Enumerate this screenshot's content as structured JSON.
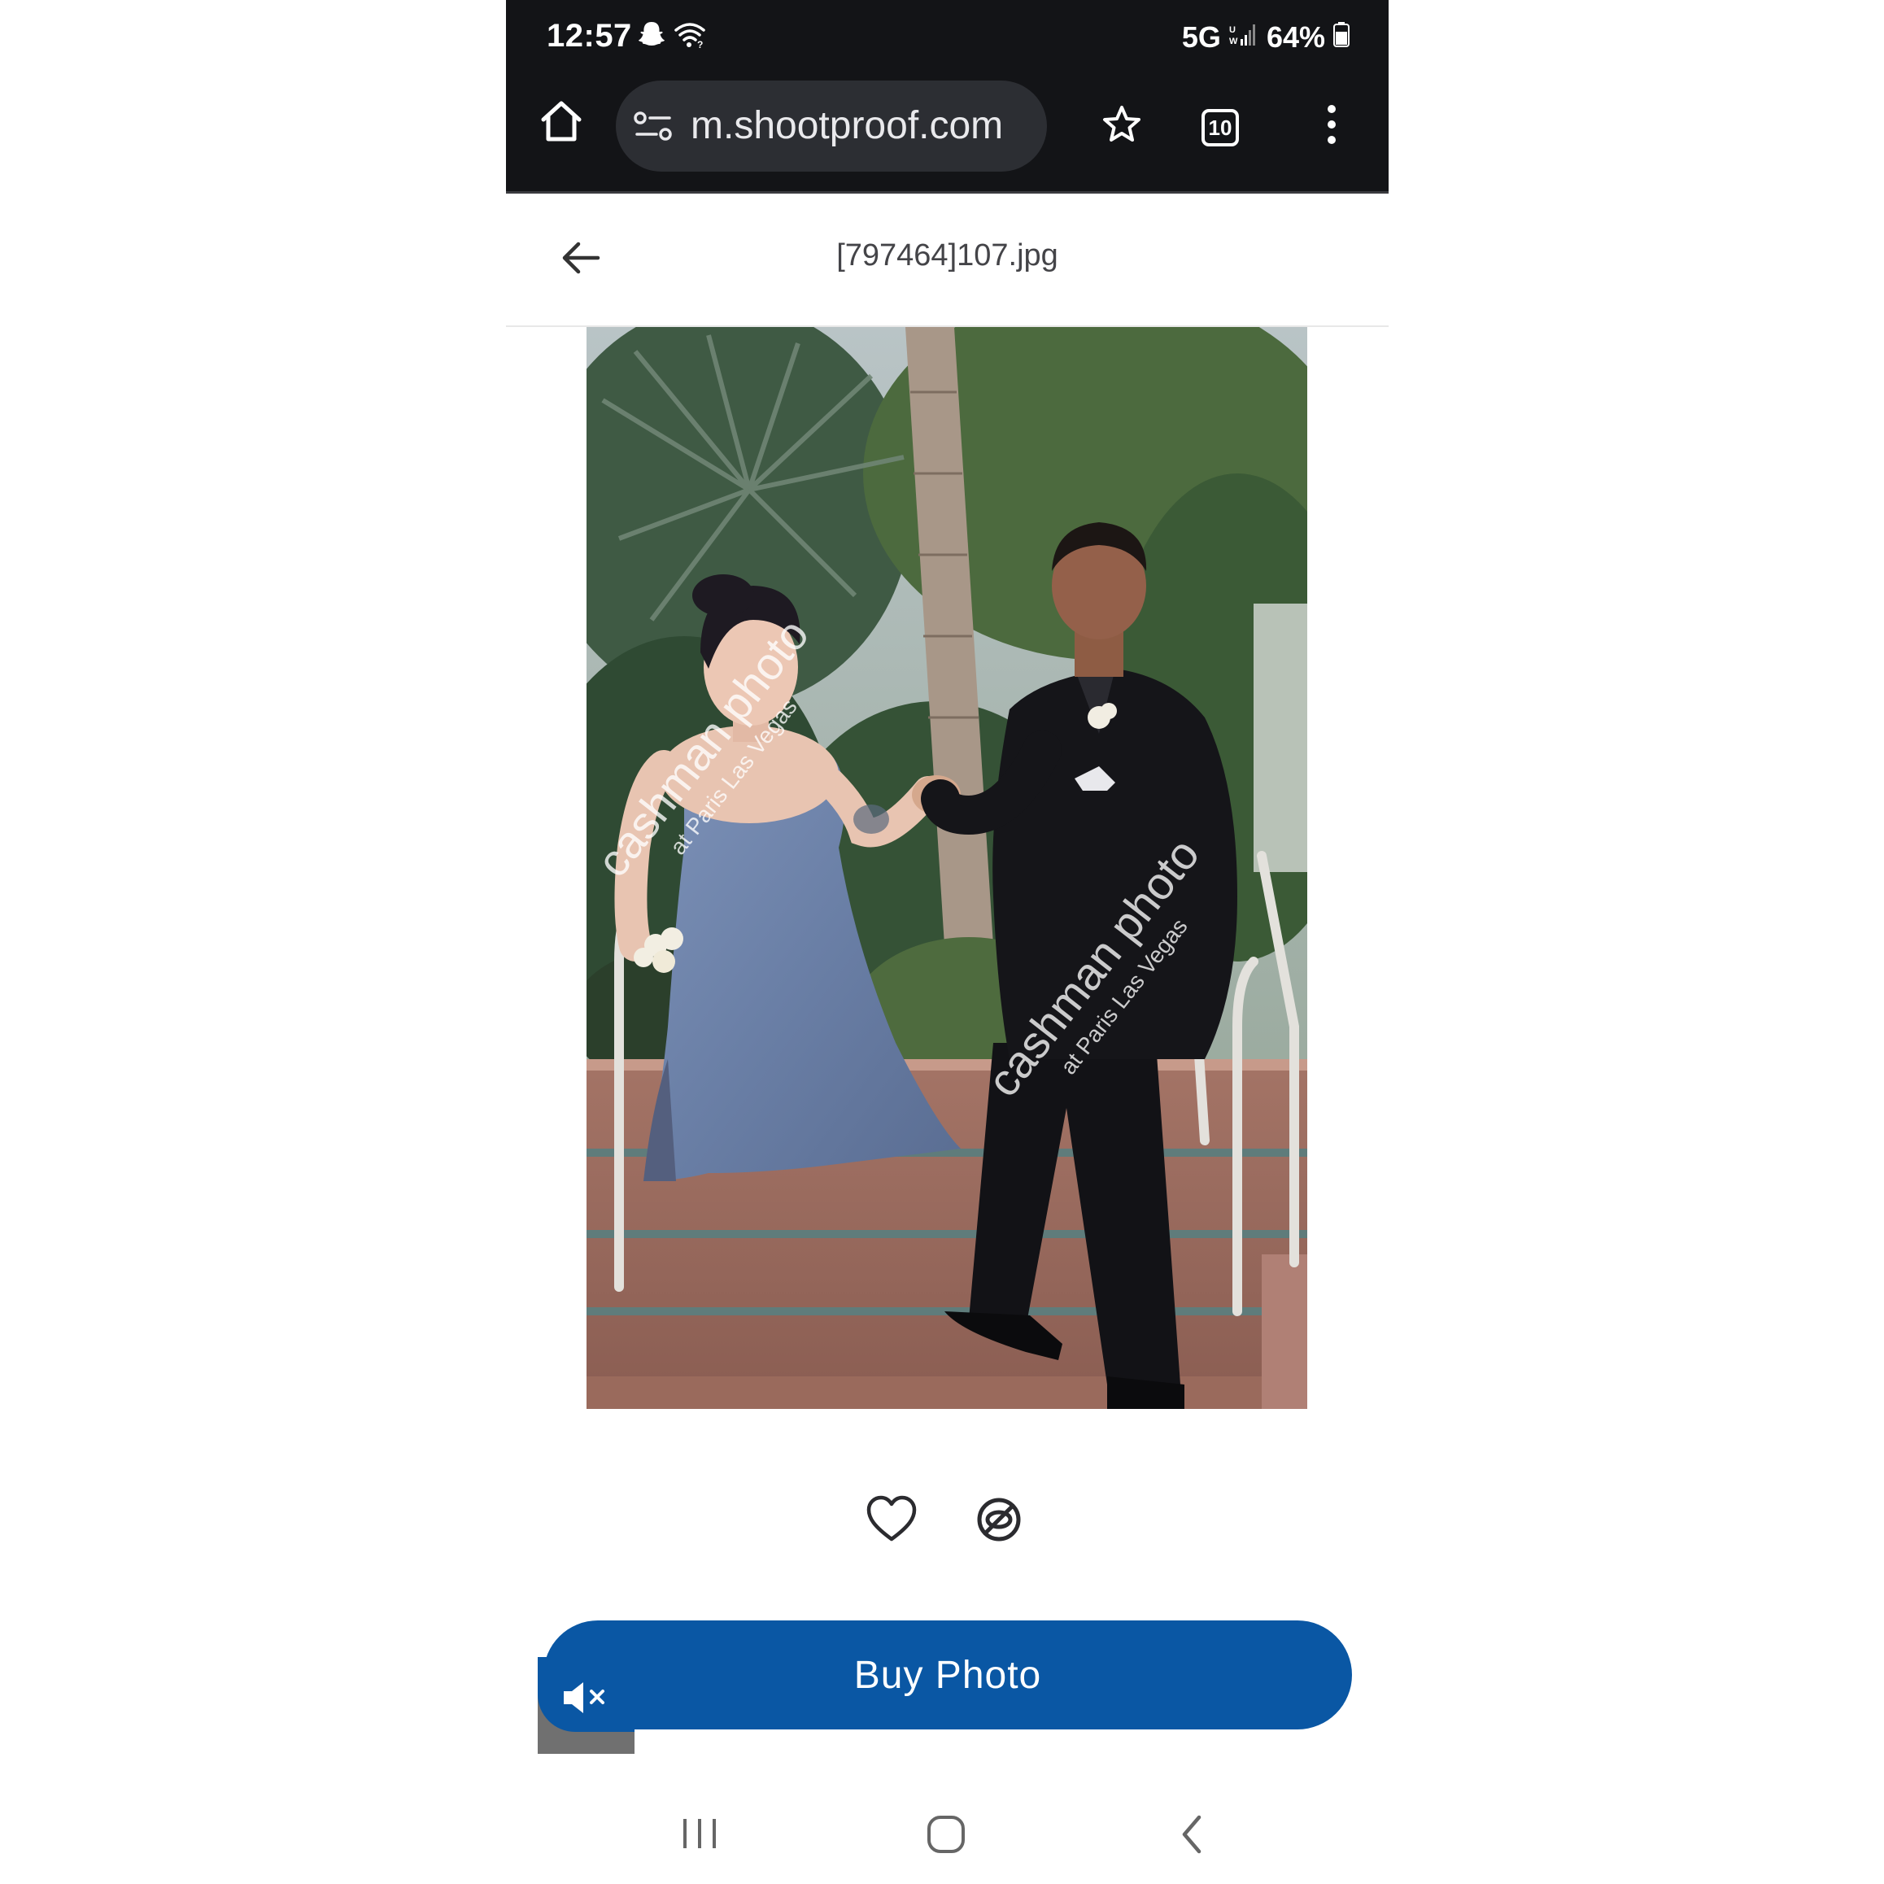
{
  "status_bar": {
    "time": "12:57",
    "network": "5G",
    "battery": "64%",
    "icons": [
      "snapchat-icon",
      "wifi-icon",
      "signal-icon",
      "battery-icon"
    ]
  },
  "browser": {
    "url": "m.shootproof.com",
    "tab_count": "10",
    "icons": [
      "home-icon",
      "site-settings-icon",
      "bookmark-star-icon",
      "tabs-icon",
      "more-menu-icon"
    ]
  },
  "page": {
    "title": "[797464]107.jpg"
  },
  "photo": {
    "watermark_brand": "cashman photo",
    "watermark_location": "at Paris Las Vegas"
  },
  "actions": {
    "buy_label": "Buy Photo",
    "icons": [
      "heart-icon",
      "hide-icon",
      "mute-icon"
    ]
  },
  "nav": {
    "icons": [
      "recent-apps-icon",
      "home-nav-icon",
      "back-nav-icon"
    ]
  },
  "colors": {
    "accent": "#0a57a4",
    "status_bar_bg": "#131417",
    "url_pill_bg": "#2c2e33"
  }
}
